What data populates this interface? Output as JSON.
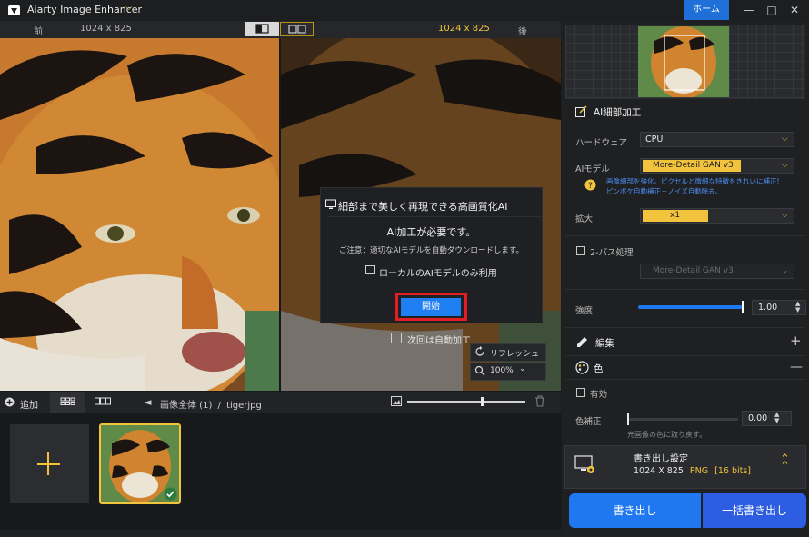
{
  "app": {
    "title": "Aiarty Image Enhancer",
    "home_label": "ホーム",
    "accent": "#f2c43d",
    "primary_blue": "#1f78ef"
  },
  "compare": {
    "before_label": "前",
    "before_size": "1024 x 825",
    "after_size": "1024 x 825",
    "after_label": "後"
  },
  "dialog": {
    "title": "細部まで美しく再現できる高画質化AI",
    "message": "AI加工が必要です。",
    "note": "ご注意：適切なAIモデルを自動ダウンロードします。",
    "local_only_label": "ローカルのAIモデルのみ利用",
    "start_label": "開始"
  },
  "preview_overlay": {
    "auto_label": "次回は自動加工",
    "refresh_label": "リフレッシュ",
    "zoom_value": "100%"
  },
  "bottom_bar": {
    "add_label": "追加",
    "breadcrumb_root": "画像全体 (1)",
    "breadcrumb_sep": "/",
    "breadcrumb_file": "tigerjpg",
    "zoom_fraction": 0.63
  },
  "panel": {
    "ai_detail_title": "AI細部加工",
    "hardware_label": "ハードウェア",
    "hardware_value": "CPU",
    "ai_model_label": "AIモデル",
    "ai_model_value": "More-Detail GAN  v3",
    "model_desc_line1": "画像細部を強化。ピクセルと微細な特徴をきれいに補正!",
    "model_desc_line2": "ピンボケ自動補正＋ノイズ自動除去。",
    "scale_label": "拡大",
    "scale_value": "x1",
    "two_pass_label": "2-パス処理",
    "two_pass_model": "More-Detail GAN  v3",
    "strength_label": "強度",
    "strength_value": "1.00",
    "strength_fraction": 1.0,
    "edit_title": "編集",
    "color_title": "色",
    "enable_label": "有効",
    "color_correct_label": "色補正",
    "color_correct_value": "0.00",
    "color_correct_hint": "元画像の色に取り戻す。",
    "export_title": "書き出し設定",
    "export_size": "1024 X 825",
    "export_format": "PNG",
    "export_bits": "[16 bits]",
    "export_button": "書き出し",
    "batch_button": "一括書き出し"
  }
}
